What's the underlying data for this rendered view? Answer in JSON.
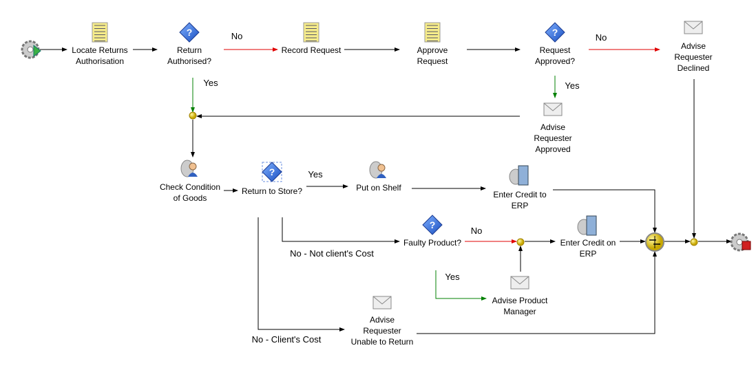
{
  "colors": {
    "normal": "#000000",
    "no": "#e00000",
    "yes": "#008000",
    "junction": "#e8d000"
  },
  "nodes": [
    {
      "id": "start",
      "type": "start",
      "icon": "gear-start-icon",
      "label": []
    },
    {
      "id": "locate",
      "type": "form",
      "icon": "form-icon",
      "label": [
        "Locate Returns",
        "Authorisation"
      ]
    },
    {
      "id": "return-authorised",
      "type": "decision",
      "icon": "question-diamond-icon",
      "label": [
        "Return",
        "Authorised?"
      ]
    },
    {
      "id": "record",
      "type": "form",
      "icon": "form-icon",
      "label": [
        "Record Request"
      ]
    },
    {
      "id": "approve",
      "type": "form",
      "icon": "form-icon",
      "label": [
        "Approve",
        "Request"
      ]
    },
    {
      "id": "request-approved",
      "type": "decision",
      "icon": "question-diamond-icon",
      "label": [
        "Request",
        "Approved?"
      ]
    },
    {
      "id": "advise-declined",
      "type": "email",
      "icon": "envelope-icon",
      "label": [
        "Advise",
        "Requester",
        "Declined"
      ]
    },
    {
      "id": "advise-approved",
      "type": "email",
      "icon": "envelope-icon",
      "label": [
        "Advise",
        "Requester",
        "Approved"
      ]
    },
    {
      "id": "j1",
      "type": "junction",
      "icon": "junction-icon",
      "label": []
    },
    {
      "id": "check",
      "type": "user",
      "icon": "user-task-icon",
      "label": [
        "Check Condition",
        "of Goods"
      ]
    },
    {
      "id": "return-store",
      "type": "decision2",
      "icon": "multi-decision-icon",
      "label": [
        "Return to Store?"
      ]
    },
    {
      "id": "shelf",
      "type": "user",
      "icon": "user-task-icon",
      "label": [
        "Put on Shelf"
      ]
    },
    {
      "id": "credit-to",
      "type": "server",
      "icon": "server-icon",
      "label": [
        "Enter Credit to",
        "ERP"
      ]
    },
    {
      "id": "faulty",
      "type": "decision",
      "icon": "question-diamond-icon",
      "label": [
        "Faulty Product?"
      ]
    },
    {
      "id": "j2",
      "type": "junction",
      "icon": "junction-icon",
      "label": []
    },
    {
      "id": "credit-on",
      "type": "server",
      "icon": "server-icon",
      "label": [
        "Enter Credit on",
        "ERP"
      ]
    },
    {
      "id": "advise-pm",
      "type": "email",
      "icon": "envelope-icon",
      "label": [
        "Advise Product",
        "Manager"
      ]
    },
    {
      "id": "advise-unable",
      "type": "email",
      "icon": "envelope-icon",
      "label": [
        "Advise",
        "Requester",
        "Unable to Return"
      ]
    },
    {
      "id": "merge",
      "type": "merge",
      "icon": "merge-icon",
      "label": []
    },
    {
      "id": "j3",
      "type": "junction",
      "icon": "junction-icon",
      "label": []
    },
    {
      "id": "end",
      "type": "end",
      "icon": "gear-end-icon",
      "label": []
    }
  ],
  "edge_labels": [
    "No",
    "Yes",
    "No",
    "Yes",
    "Yes",
    "No",
    "No - Not client's Cost",
    "Yes",
    "No - Client's Cost"
  ]
}
